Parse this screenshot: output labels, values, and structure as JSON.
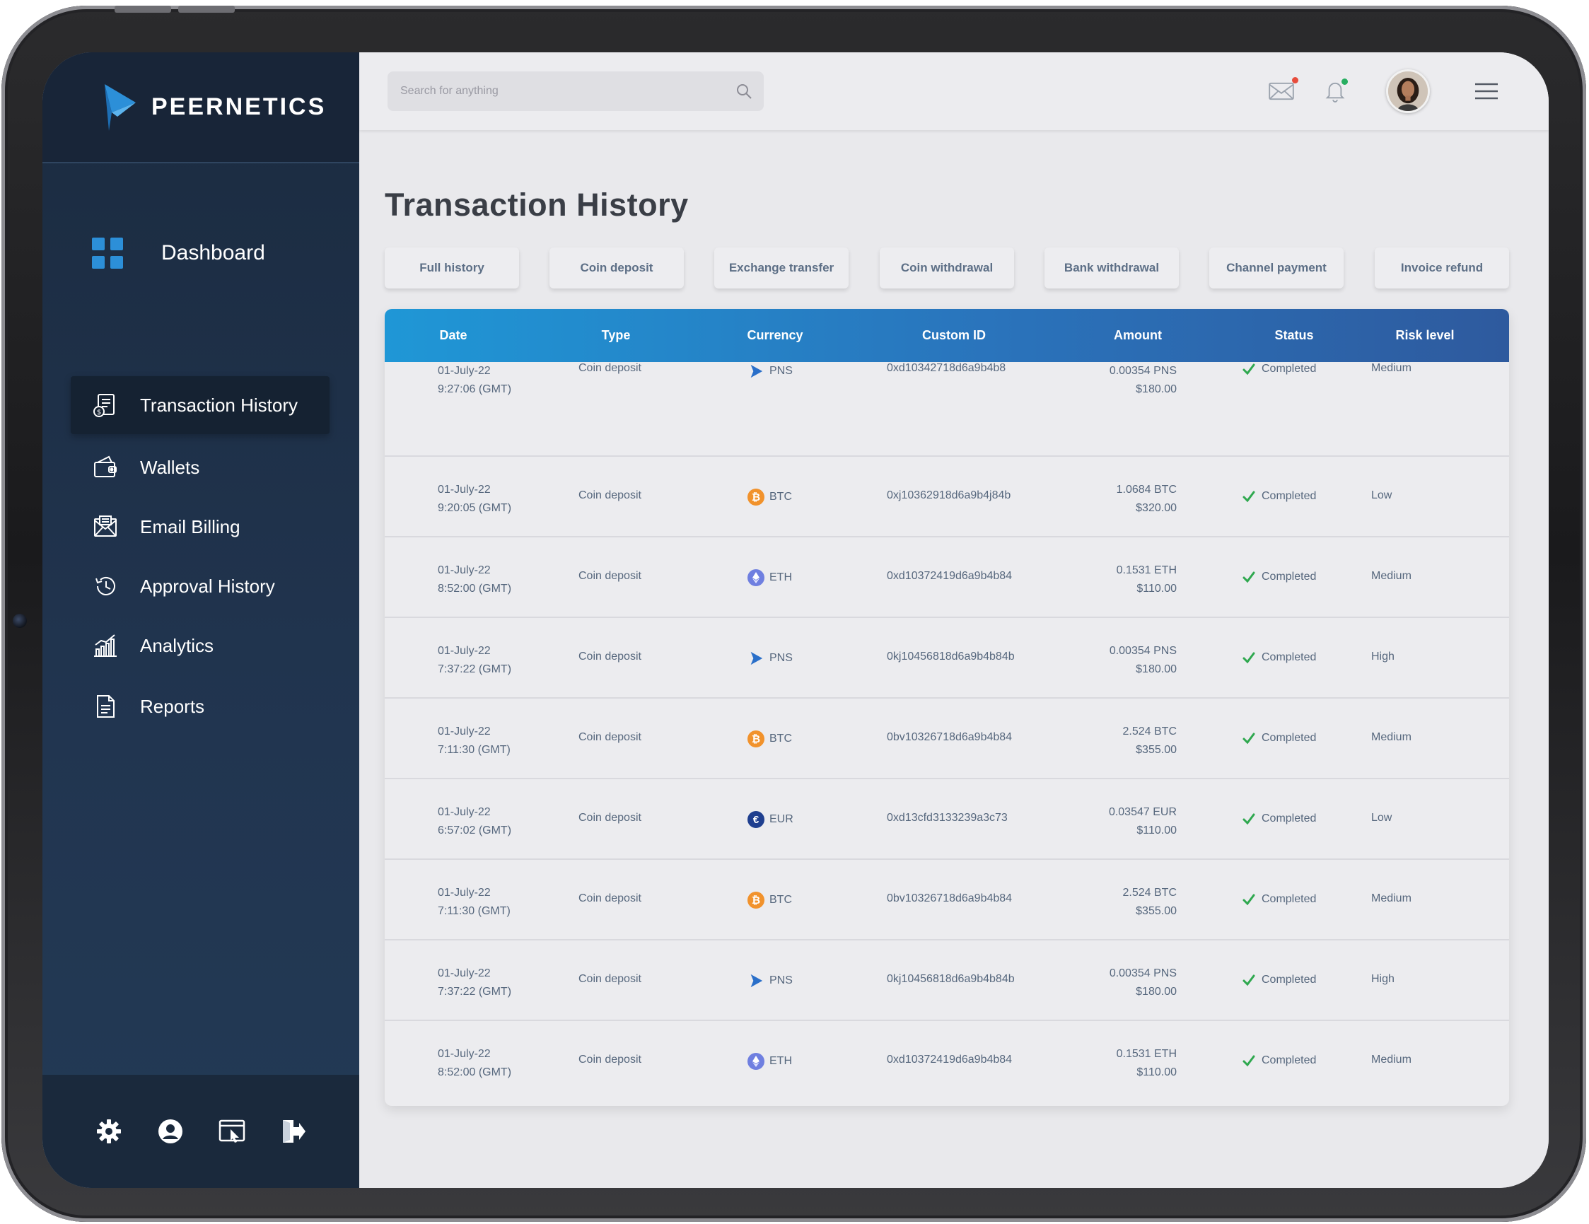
{
  "brand": {
    "name": "PEERNETICS",
    "accent": "#2c8fd8"
  },
  "sidebar": {
    "dashboard": {
      "label": "Dashboard"
    },
    "items": [
      {
        "label": "Transaction History",
        "icon": "transaction-icon",
        "active": true
      },
      {
        "label": "Wallets",
        "icon": "wallet-icon",
        "active": false
      },
      {
        "label": "Email Billing",
        "icon": "email-billing-icon",
        "active": false
      },
      {
        "label": "Approval History",
        "icon": "history-icon",
        "active": false
      },
      {
        "label": "Analytics",
        "icon": "analytics-icon",
        "active": false
      },
      {
        "label": "Reports",
        "icon": "reports-icon",
        "active": false
      }
    ],
    "bottom_icons": [
      "gear-icon",
      "user-icon",
      "browser-pointer-icon",
      "logout-icon"
    ]
  },
  "topbar": {
    "search_placeholder": "Search for anything",
    "mail_dot_color": "#e74c3c",
    "bell_dot_color": "#27ae60"
  },
  "page": {
    "title": "Transaction History"
  },
  "filters": [
    "Full history",
    "Coin deposit",
    "Exchange transfer",
    "Coin withdrawal",
    "Bank withdrawal",
    "Channel payment",
    "Invoice refund"
  ],
  "table": {
    "columns": [
      "Date",
      "Type",
      "Currency",
      "Custom ID",
      "Amount",
      "Status",
      "Risk level"
    ],
    "rows": [
      {
        "date": "01-July-22",
        "time": "9:27:06 (GMT)",
        "type": "Coin deposit",
        "currency": "PNS",
        "id": "0xd10342718d6a9b4b8",
        "amount": "0.00354 PNS",
        "usd": "$180.00",
        "status": "Completed",
        "risk": "Medium"
      },
      {
        "date": "01-July-22",
        "time": "9:20:05 (GMT)",
        "type": "Coin deposit",
        "currency": "BTC",
        "id": "0xj10362918d6a9b4j84b",
        "amount": "1.0684 BTC",
        "usd": "$320.00",
        "status": "Completed",
        "risk": "Low"
      },
      {
        "date": "01-July-22",
        "time": "8:52:00 (GMT)",
        "type": "Coin deposit",
        "currency": "ETH",
        "id": "0xd10372419d6a9b4b84",
        "amount": "0.1531 ETH",
        "usd": "$110.00",
        "status": "Completed",
        "risk": "Medium"
      },
      {
        "date": "01-July-22",
        "time": "7:37:22 (GMT)",
        "type": "Coin deposit",
        "currency": "PNS",
        "id": "0kj10456818d6a9b4b84b",
        "amount": "0.00354 PNS",
        "usd": "$180.00",
        "status": "Completed",
        "risk": "High"
      },
      {
        "date": "01-July-22",
        "time": "7:11:30 (GMT)",
        "type": "Coin deposit",
        "currency": "BTC",
        "id": "0bv10326718d6a9b4b84",
        "amount": "2.524 BTC",
        "usd": "$355.00",
        "status": "Completed",
        "risk": "Medium"
      },
      {
        "date": "01-July-22",
        "time": "6:57:02 (GMT)",
        "type": "Coin deposit",
        "currency": "EUR",
        "id": "0xd13cfd3133239a3c73",
        "amount": "0.03547 EUR",
        "usd": "$110.00",
        "status": "Completed",
        "risk": "Low"
      },
      {
        "date": "01-July-22",
        "time": "7:11:30 (GMT)",
        "type": "Coin deposit",
        "currency": "BTC",
        "id": "0bv10326718d6a9b4b84",
        "amount": "2.524 BTC",
        "usd": "$355.00",
        "status": "Completed",
        "risk": "Medium"
      },
      {
        "date": "01-July-22",
        "time": "7:37:22 (GMT)",
        "type": "Coin deposit",
        "currency": "PNS",
        "id": "0kj10456818d6a9b4b84b",
        "amount": "0.00354 PNS",
        "usd": "$180.00",
        "status": "Completed",
        "risk": "High"
      },
      {
        "date": "01-July-22",
        "time": "8:52:00 (GMT)",
        "type": "Coin deposit",
        "currency": "ETH",
        "id": "0xd10372419d6a9b4b84",
        "amount": "0.1531 ETH",
        "usd": "$110.00",
        "status": "Completed",
        "risk": "Medium"
      }
    ]
  },
  "currency_icons": {
    "PNS": {
      "icon": "pns-icon",
      "color": "#2a6fc9"
    },
    "BTC": {
      "icon": "bitcoin-icon",
      "color": "#f1922c",
      "glyph": "₿"
    },
    "ETH": {
      "icon": "ethereum-icon",
      "color": "#6f7fe0"
    },
    "EUR": {
      "icon": "euro-icon",
      "color": "#1f3f8f",
      "glyph": "€"
    }
  },
  "status_color": "#2fa84f"
}
